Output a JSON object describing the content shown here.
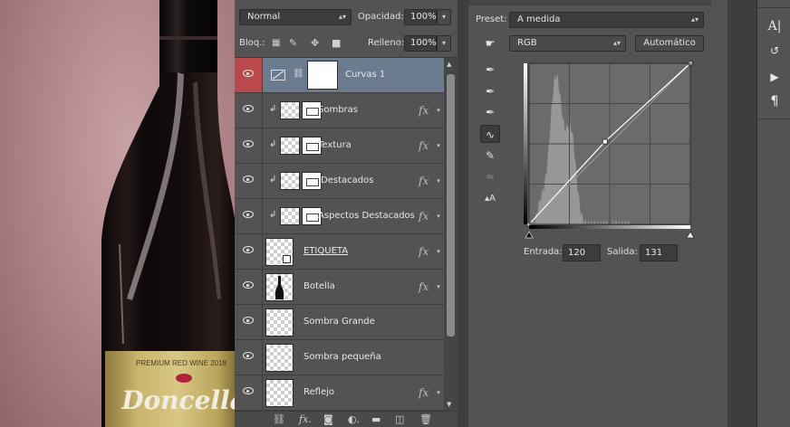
{
  "layers_panel": {
    "blend_mode": "Normal",
    "opacity_label": "Opacidad:",
    "opacity_value": "100%",
    "lock_label": "Bloq.:",
    "fill_label": "Relleno:",
    "fill_value": "100%",
    "layers": [
      {
        "name": "Curvas 1",
        "type": "adjustment",
        "selected": true,
        "clipped": false,
        "fx": false
      },
      {
        "name": "Sombras",
        "type": "clipped",
        "selected": false,
        "clipped": true,
        "fx": true
      },
      {
        "name": "Textura",
        "type": "clipped",
        "selected": false,
        "clipped": true,
        "fx": true
      },
      {
        "name": "Destacados",
        "type": "clipped",
        "selected": false,
        "clipped": true,
        "fx": true
      },
      {
        "name": "Aspectos Destacados",
        "type": "clipped",
        "selected": false,
        "clipped": true,
        "fx": true
      },
      {
        "name": "ETIQUETA",
        "type": "smart",
        "selected": false,
        "clipped": false,
        "fx": true
      },
      {
        "name": "Botella",
        "type": "pixel",
        "selected": false,
        "clipped": false,
        "fx": true
      },
      {
        "name": "Sombra Grande",
        "type": "pixel",
        "selected": false,
        "clipped": false,
        "fx": false
      },
      {
        "name": "Sombra pequeña",
        "type": "pixel",
        "selected": false,
        "clipped": false,
        "fx": false
      },
      {
        "name": "Reflejo",
        "type": "pixel",
        "selected": false,
        "clipped": false,
        "fx": true
      }
    ],
    "fx_symbol": "fx"
  },
  "curves_panel": {
    "preset_label": "Preset:",
    "preset_value": "A medida",
    "channel_value": "RGB",
    "auto_button": "Automático",
    "input_label": "Entrada:",
    "input_value": "120",
    "output_label": "Salida:",
    "output_value": "131",
    "curve_point": {
      "input": 120,
      "output": 131
    }
  },
  "canvas": {
    "label_top": "PREMIUM RED WINE 2018",
    "label_brand": "Doncella"
  },
  "colors": {
    "panel_bg": "#535353",
    "selected_layer": "#6b7c91",
    "visibility_active": "#b9494a",
    "histogram": "#9a9a9a"
  }
}
